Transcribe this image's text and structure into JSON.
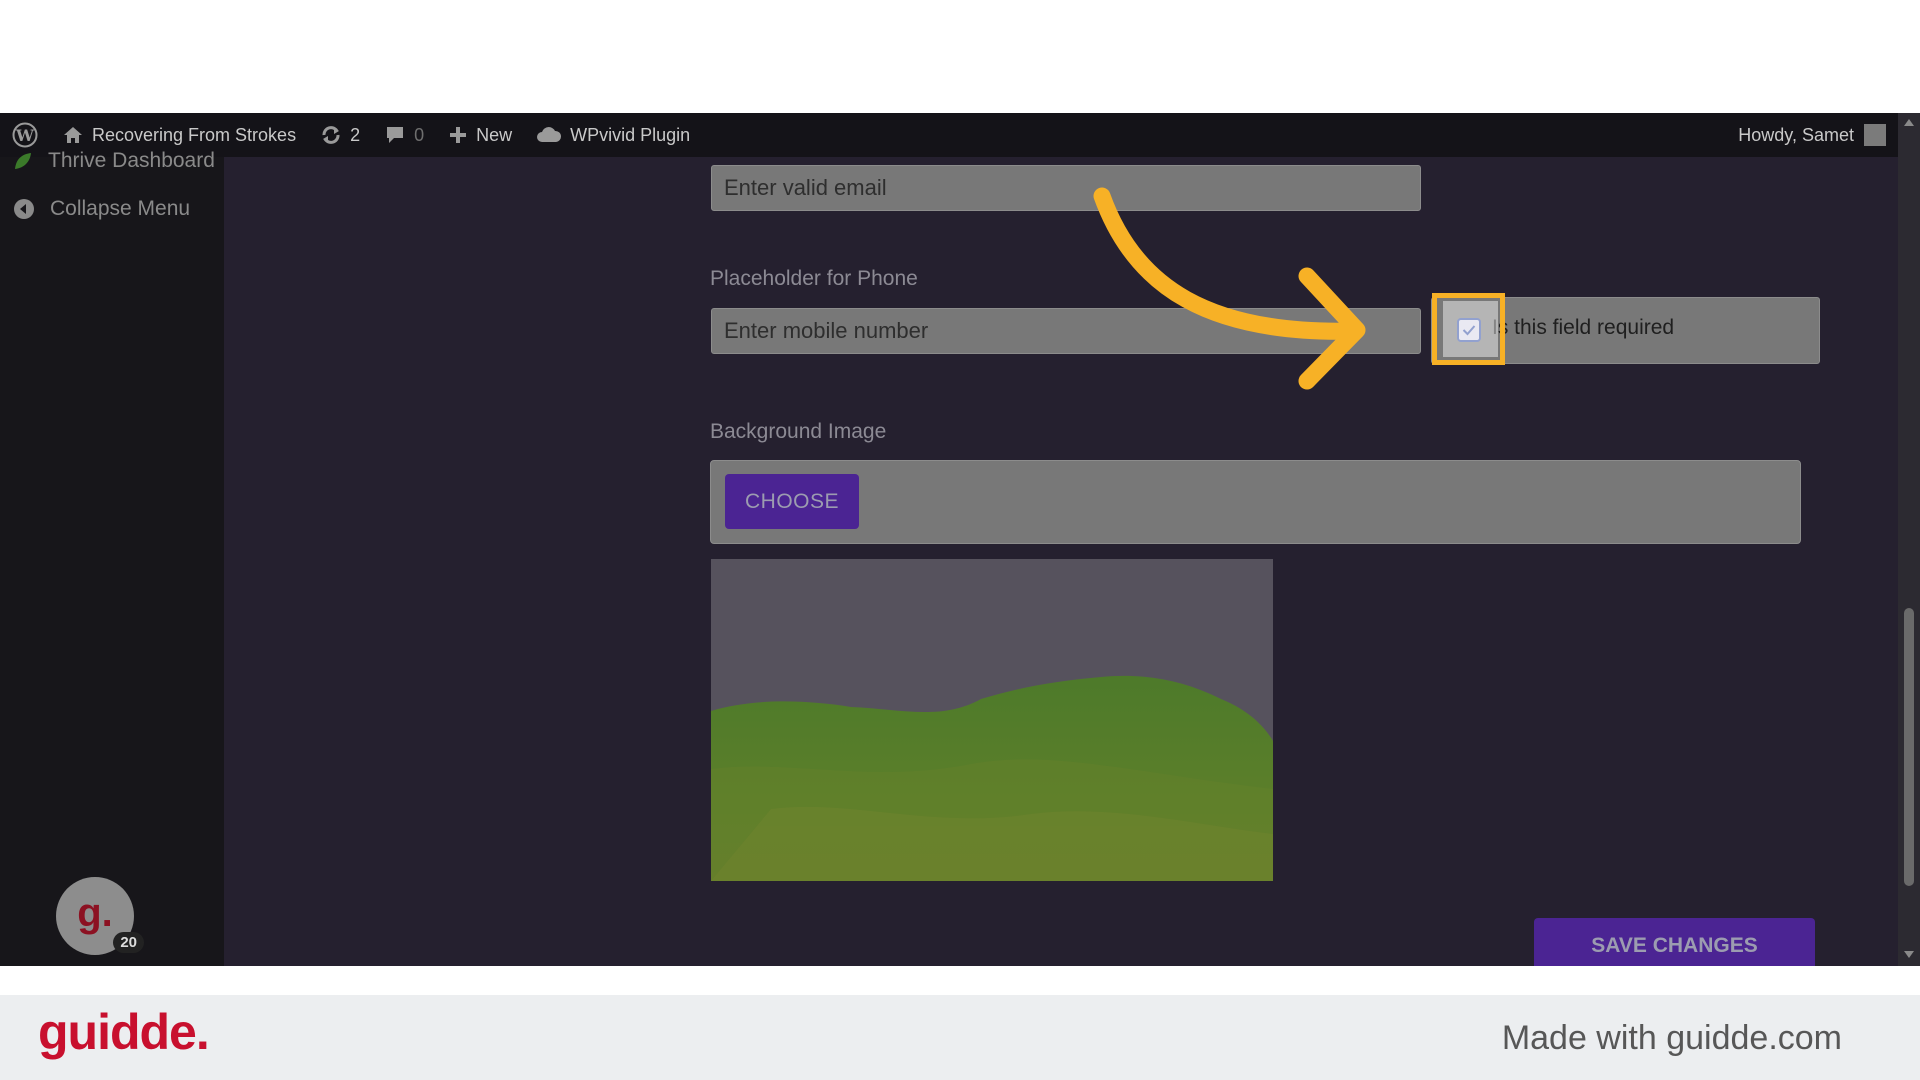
{
  "adminbar": {
    "site_name": "Recovering From Strokes",
    "updates_count": "2",
    "comments_count": "0",
    "new_label": "New",
    "plugin_label": "WPvivid Plugin",
    "greeting": "Howdy, Samet"
  },
  "sidebar": {
    "partial_item_label": "Thrive Dashboard",
    "collapse_label": "Collapse Menu",
    "guidde_badge_letter": "g.",
    "guidde_badge_count": "20"
  },
  "form": {
    "email_value": "Enter valid email",
    "phone_label": "Placeholder for Phone",
    "phone_value": "Enter mobile number",
    "required_label": "Is this field required",
    "required_checked": true,
    "background_label": "Background Image",
    "choose_label": "CHOOSE",
    "save_label": "SAVE CHANGES"
  },
  "overlay": {
    "highlight_color": "#f7b126",
    "arrow_color": "#f7b126"
  },
  "footer": {
    "brand": "guidde.",
    "made_with": "Made with guidde.com"
  },
  "colors": {
    "admin_bar": "#141318",
    "panel": "#25202f",
    "accent_purple": "#4b2493",
    "brand_red": "#c8102e"
  }
}
